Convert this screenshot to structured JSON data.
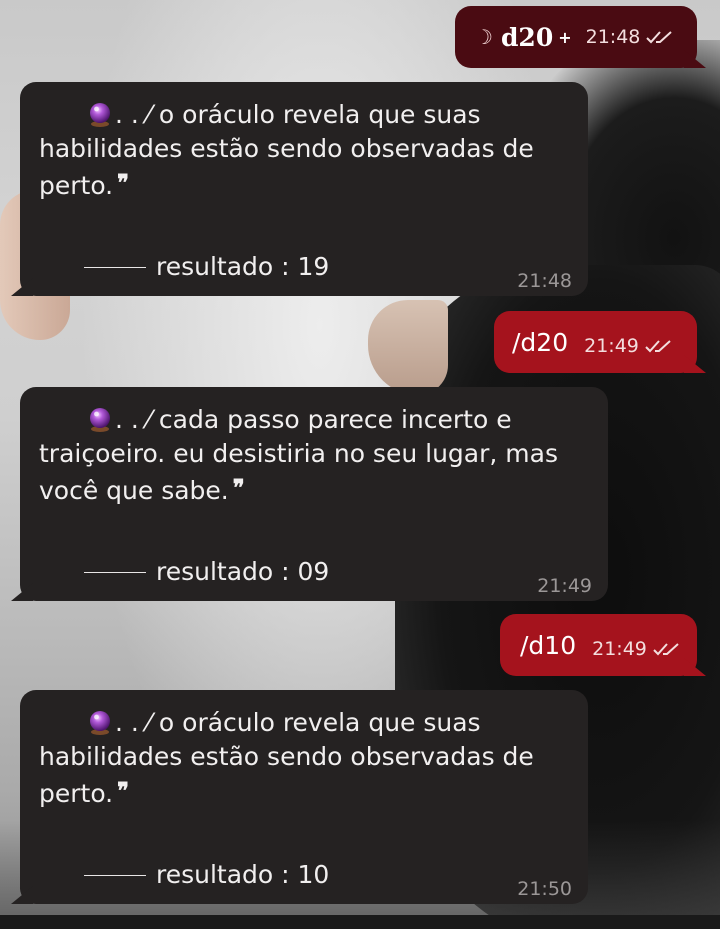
{
  "messages": [
    {
      "type": "outgoing",
      "prefix_glyph": "☽",
      "text": "d20",
      "suffix_glyph": "+",
      "time": "21:48",
      "status": "read",
      "bubble_color": "#4a0b12"
    },
    {
      "type": "incoming",
      "icon": "crystal-ball",
      "text": ". . ⁄ o oráculo revela que suas habilidades estão sendo observadas de perto.",
      "result_label": "resultado : 19",
      "time": "21:48"
    },
    {
      "type": "outgoing",
      "text": "/d20",
      "time": "21:49",
      "status": "read",
      "bubble_color": "#a5131d"
    },
    {
      "type": "incoming",
      "icon": "crystal-ball",
      "text": ". . ⁄ cada passo parece incerto e traiçoeiro. eu desistiria no seu lugar, mas você que sabe.",
      "result_label": "resultado : 09",
      "time": "21:49"
    },
    {
      "type": "outgoing",
      "text": "/d10",
      "time": "21:49",
      "status": "read",
      "bubble_color": "#a5131d"
    },
    {
      "type": "incoming",
      "icon": "crystal-ball",
      "text": ". . ⁄ o oráculo revela que suas habilidades estão sendo observadas de perto.",
      "result_label": "resultado : 10",
      "time": "21:50"
    }
  ],
  "colors": {
    "incoming_bubble": "#252222",
    "outgoing_bubble": "#a5131d",
    "outgoing_bubble_dark": "#4a0b12",
    "timestamp_in": "#9b9797"
  },
  "closing_quote": "❞"
}
